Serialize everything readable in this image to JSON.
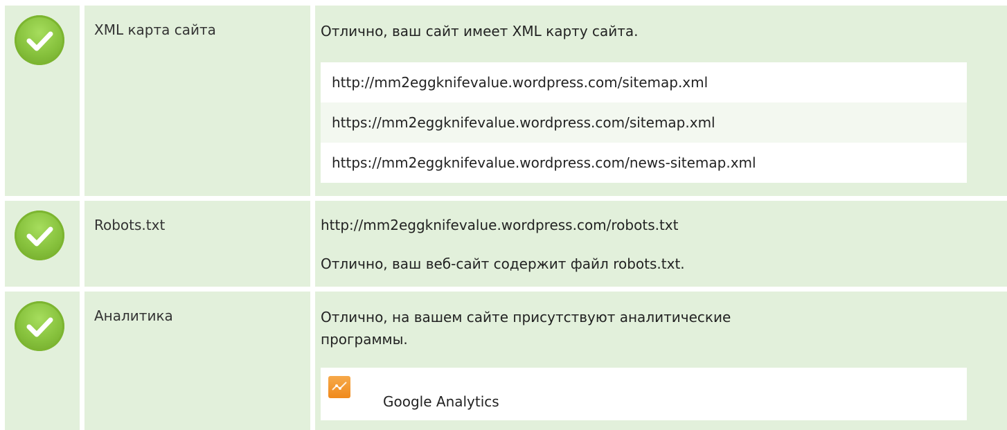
{
  "rows": [
    {
      "icon": "check-circle-icon",
      "label": "XML карта сайта",
      "intro": "Отлично, ваш сайт имеет XML карту сайта.",
      "sitemaps": [
        "http://mm2eggknifevalue.wordpress.com/sitemap.xml",
        "https://mm2eggknifevalue.wordpress.com/sitemap.xml",
        "https://mm2eggknifevalue.wordpress.com/news-sitemap.xml"
      ]
    },
    {
      "icon": "check-circle-icon",
      "label": "Robots.txt",
      "url": "http://mm2eggknifevalue.wordpress.com/robots.txt",
      "message": "Отлично, ваш веб-сайт содержит файл robots.txt."
    },
    {
      "icon": "check-circle-icon",
      "label": "Аналитика",
      "intro": "Отлично, на вашем сайте присутствуют аналитические программы.",
      "tool": {
        "icon": "analytics-chart-icon",
        "name": "Google Analytics"
      }
    }
  ],
  "colors": {
    "row_bg": "#e2f0db",
    "check_green": "#86c13c",
    "analytics_orange": "#f08a1c"
  }
}
